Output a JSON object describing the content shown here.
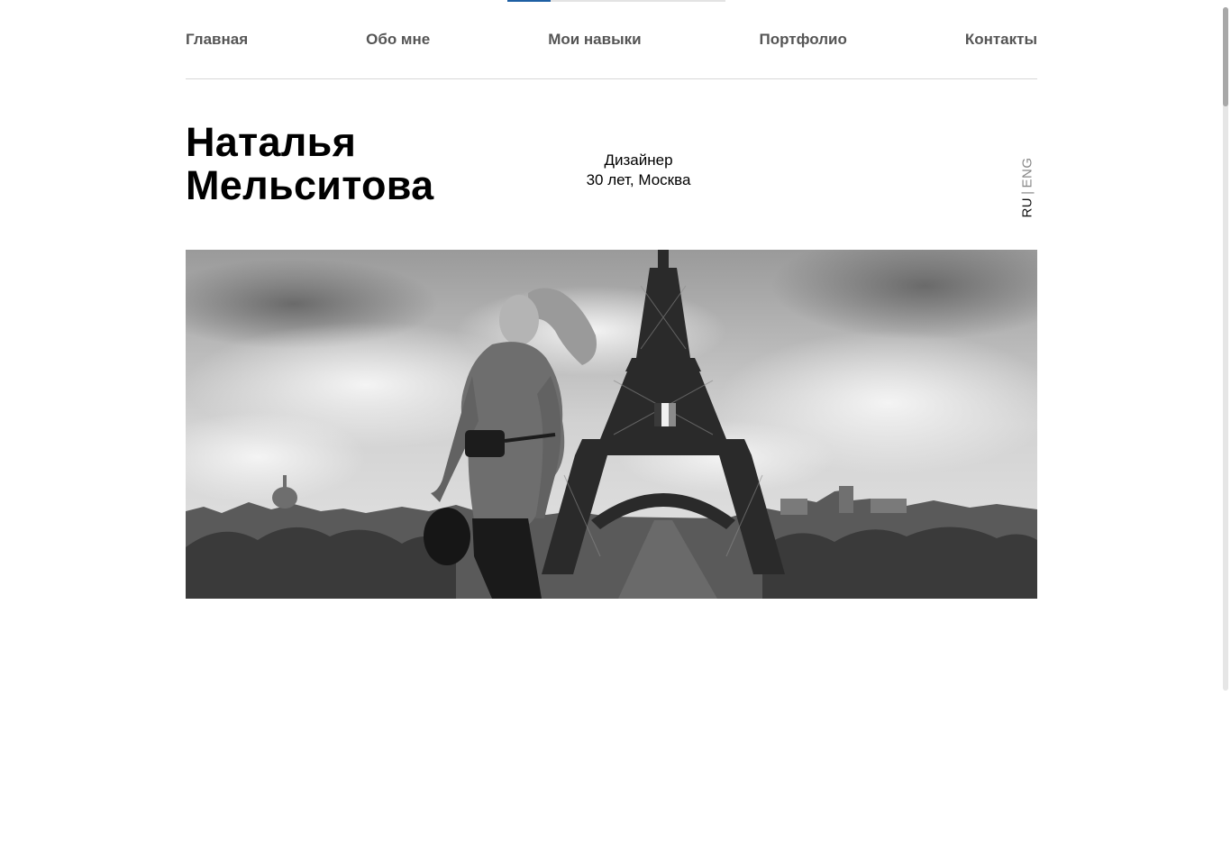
{
  "reading_progress": 0.2,
  "nav": {
    "items": [
      {
        "label": "Главная"
      },
      {
        "label": "Обо мне"
      },
      {
        "label": "Мои навыки"
      },
      {
        "label": "Портфолио"
      },
      {
        "label": "Контакты"
      }
    ]
  },
  "hero": {
    "first_name": "Наталья",
    "last_name": "Мельситова",
    "role": "Дизайнер",
    "age_city": "30 лет, Москва"
  },
  "lang": {
    "ru": "RU",
    "separator": "|",
    "eng": "ENG"
  },
  "colors": {
    "nav_text": "#555555",
    "progress": "#1e5fa3",
    "divider": "#d8d8d8"
  }
}
